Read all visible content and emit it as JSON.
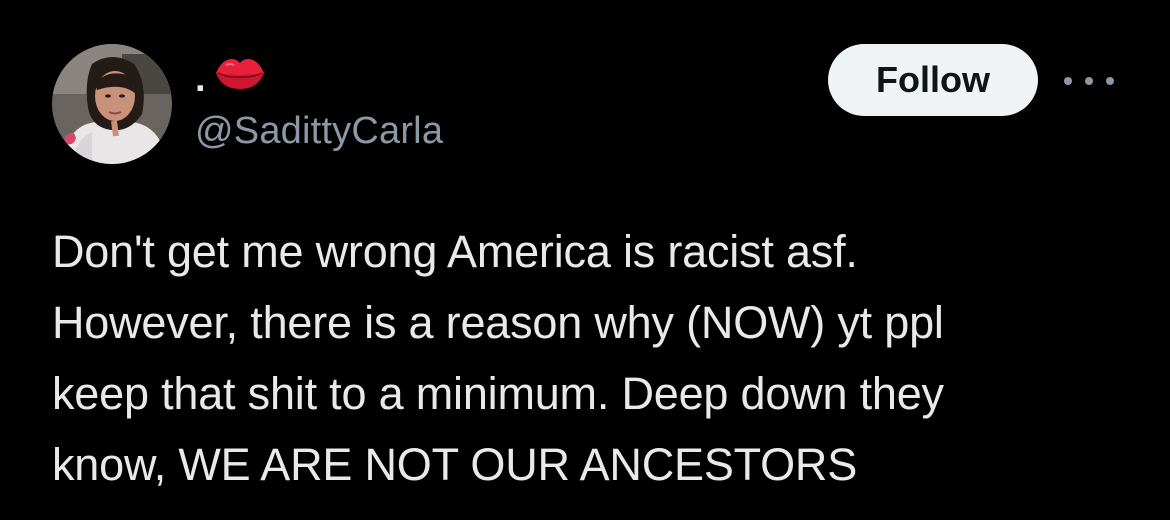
{
  "author": {
    "display_name": ".",
    "display_emoji": "kiss-mark-icon",
    "handle": "@SadittyCarla"
  },
  "actions": {
    "follow_label": "Follow",
    "more_icon": "more-horizontal-icon"
  },
  "tweet": {
    "text": "Don't get me wrong America is racist asf.\nHowever, there is a reason why (NOW) yt ppl\nkeep that shit to a minimum. Deep down they\nknow, WE ARE NOT OUR ANCESTORS"
  },
  "colors": {
    "background": "#000000",
    "text": "#e7e9ea",
    "secondary_text": "#8b98a5",
    "follow_bg": "#eff3f4",
    "follow_text": "#0f1419",
    "lips": "#e8203a"
  }
}
